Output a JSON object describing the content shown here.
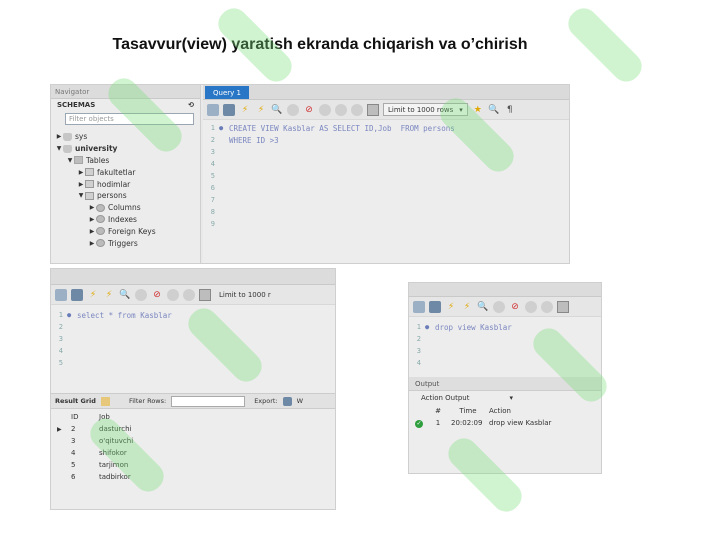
{
  "slide": {
    "title": "Tasavvur(view) yaratish ekranda chiqarish va o’chirish"
  },
  "navigator": {
    "header": "Navigator",
    "schemas_label": "SCHEMAS",
    "filter_placeholder": "Filter objects",
    "tree": [
      {
        "label": "sys",
        "indent": 0,
        "arrow": "▶",
        "icon": "database",
        "bold": false
      },
      {
        "label": "university",
        "indent": 0,
        "arrow": "▼",
        "icon": "database",
        "bold": true
      },
      {
        "label": "Tables",
        "indent": 1,
        "arrow": "▼",
        "icon": "folder",
        "bold": false
      },
      {
        "label": "fakultetlar",
        "indent": 2,
        "arrow": "▶",
        "icon": "table",
        "bold": false
      },
      {
        "label": "hodimlar",
        "indent": 2,
        "arrow": "▶",
        "icon": "table",
        "bold": false
      },
      {
        "label": "persons",
        "indent": 2,
        "arrow": "▼",
        "icon": "table",
        "bold": false
      },
      {
        "label": "Columns",
        "indent": 3,
        "arrow": "▶",
        "icon": "gear",
        "bold": false
      },
      {
        "label": "Indexes",
        "indent": 3,
        "arrow": "▶",
        "icon": "gear",
        "bold": false
      },
      {
        "label": "Foreign Keys",
        "indent": 3,
        "arrow": "▶",
        "icon": "gear",
        "bold": false
      },
      {
        "label": "Triggers",
        "indent": 3,
        "arrow": "▶",
        "icon": "gear",
        "bold": false
      }
    ]
  },
  "query_editor": {
    "tab_label": "Query 1",
    "limit_label": "Limit to 1000 rows",
    "lines": [
      {
        "n": "1",
        "dot": "●",
        "code": "CREATE VIEW Kasblar AS SELECT ID,Job  FROM persons"
      },
      {
        "n": "2",
        "dot": "",
        "code": "WHERE ID >3"
      },
      {
        "n": "3",
        "dot": "",
        "code": ""
      },
      {
        "n": "4",
        "dot": "",
        "code": ""
      },
      {
        "n": "5",
        "dot": "",
        "code": ""
      },
      {
        "n": "6",
        "dot": "",
        "code": ""
      },
      {
        "n": "7",
        "dot": "",
        "code": ""
      },
      {
        "n": "8",
        "dot": "",
        "code": ""
      },
      {
        "n": "9",
        "dot": "",
        "code": ""
      }
    ]
  },
  "select_editor": {
    "limit_label": "Limit to 1000 r",
    "lines": [
      {
        "n": "1",
        "dot": "●",
        "code": "select * from Kasblar"
      },
      {
        "n": "2",
        "dot": "",
        "code": ""
      },
      {
        "n": "3",
        "dot": "",
        "code": ""
      },
      {
        "n": "4",
        "dot": "",
        "code": ""
      },
      {
        "n": "5",
        "dot": "",
        "code": ""
      }
    ],
    "grid_toolbar": {
      "result_label": "Result Grid",
      "filter_label": "Filter Rows:",
      "export_label": "Export:",
      "wrap_label": "W"
    },
    "columns": [
      "ID",
      "Job"
    ],
    "rows": [
      {
        "id": "2",
        "job": "dasturchi"
      },
      {
        "id": "3",
        "job": "o'qituvchi"
      },
      {
        "id": "4",
        "job": "shifokor"
      },
      {
        "id": "5",
        "job": "tarjimon"
      },
      {
        "id": "6",
        "job": "tadbirkor"
      }
    ]
  },
  "drop_editor": {
    "lines": [
      {
        "n": "1",
        "dot": "●",
        "code": "drop view Kasblar"
      },
      {
        "n": "2",
        "dot": "",
        "code": ""
      },
      {
        "n": "3",
        "dot": "",
        "code": ""
      },
      {
        "n": "4",
        "dot": "",
        "code": ""
      }
    ],
    "output_header": "Output",
    "output_select": "Action Output",
    "output_columns": {
      "hash": "#",
      "time": "Time",
      "action": "Action"
    },
    "output_row": {
      "n": "1",
      "time": "20:02:09",
      "action": "drop view Kasblar"
    }
  },
  "colors": {
    "accent": "#2a76c6",
    "watermark": "#78dc78",
    "success": "#2e9e3e"
  }
}
